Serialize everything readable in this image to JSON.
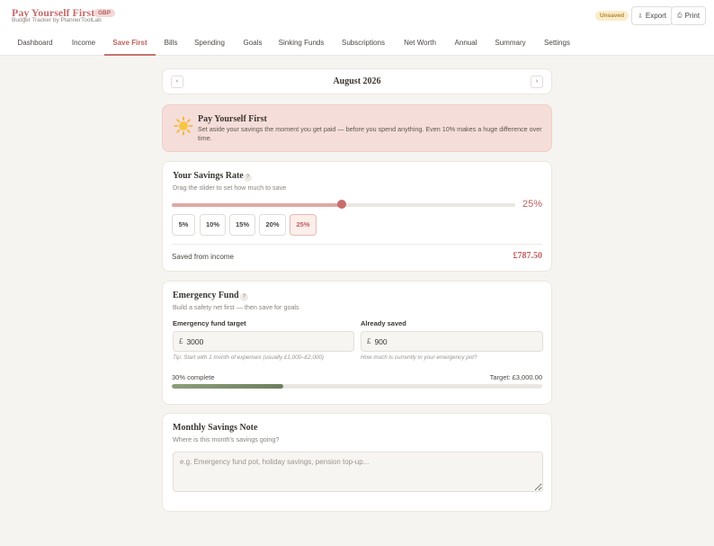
{
  "header": {
    "title": "Pay Yourself First",
    "currency_badge": "GBP",
    "subtitle": "Budget Tracker by PlannerToolLab",
    "status_badge": "Unsaved",
    "export_label": "Export",
    "print_label": "Print"
  },
  "nav": {
    "tabs": [
      {
        "label": "Dashboard"
      },
      {
        "label": "Income"
      },
      {
        "label": "Save First",
        "active": true
      },
      {
        "label": "Bills"
      },
      {
        "label": "Spending"
      },
      {
        "label": "Goals"
      },
      {
        "label": "Sinking Funds"
      },
      {
        "label": "Subscriptions"
      },
      {
        "label": "Net Worth"
      },
      {
        "label": "Annual"
      },
      {
        "label": "Summary"
      },
      {
        "label": "Settings"
      }
    ]
  },
  "month": {
    "prev_icon": "chevron-left-icon",
    "label": "August 2026",
    "next_icon": "chevron-right-icon"
  },
  "banner": {
    "icon": "sun-icon",
    "title": "Pay Yourself First",
    "text": "Set aside your savings the moment you get paid — before you spend anything. Even 10% makes a huge difference over time."
  },
  "savings_rate": {
    "title": "Your Savings Rate",
    "subtitle": "Drag the slider to set how much to save",
    "value_percent": 25,
    "value_label": "25%",
    "presets": [
      "5%",
      "10%",
      "15%",
      "20%",
      "25%"
    ],
    "active_preset": "25%",
    "saved_label": "Saved from income",
    "saved_value": "£787.50"
  },
  "emergency_fund": {
    "title": "Emergency Fund",
    "subtitle": "Build a safety net first — then save for goals",
    "target_label": "Emergency fund target",
    "target_currency": "£",
    "target_value": "3000",
    "target_tip": "Tip: Start with 1 month of expenses (usually £1,000–£2,000)",
    "saved_label": "Already saved",
    "saved_currency": "£",
    "saved_value": "900",
    "saved_tip": "How much is currently in your emergency pot?",
    "progress_fraction": 0.3,
    "progress_label": "30% complete",
    "target_text": "Target: £3,000.00"
  },
  "note": {
    "title": "Monthly Savings Note",
    "subtitle": "Where is this month's savings going?",
    "placeholder": "e.g. Emergency fund pot, holiday savings, pension top-up..."
  },
  "colors": {
    "accent": "#c86c6c",
    "banner_bg": "#f5ddd9",
    "progress": "#7a8d69",
    "background": "#f6f4f0"
  }
}
